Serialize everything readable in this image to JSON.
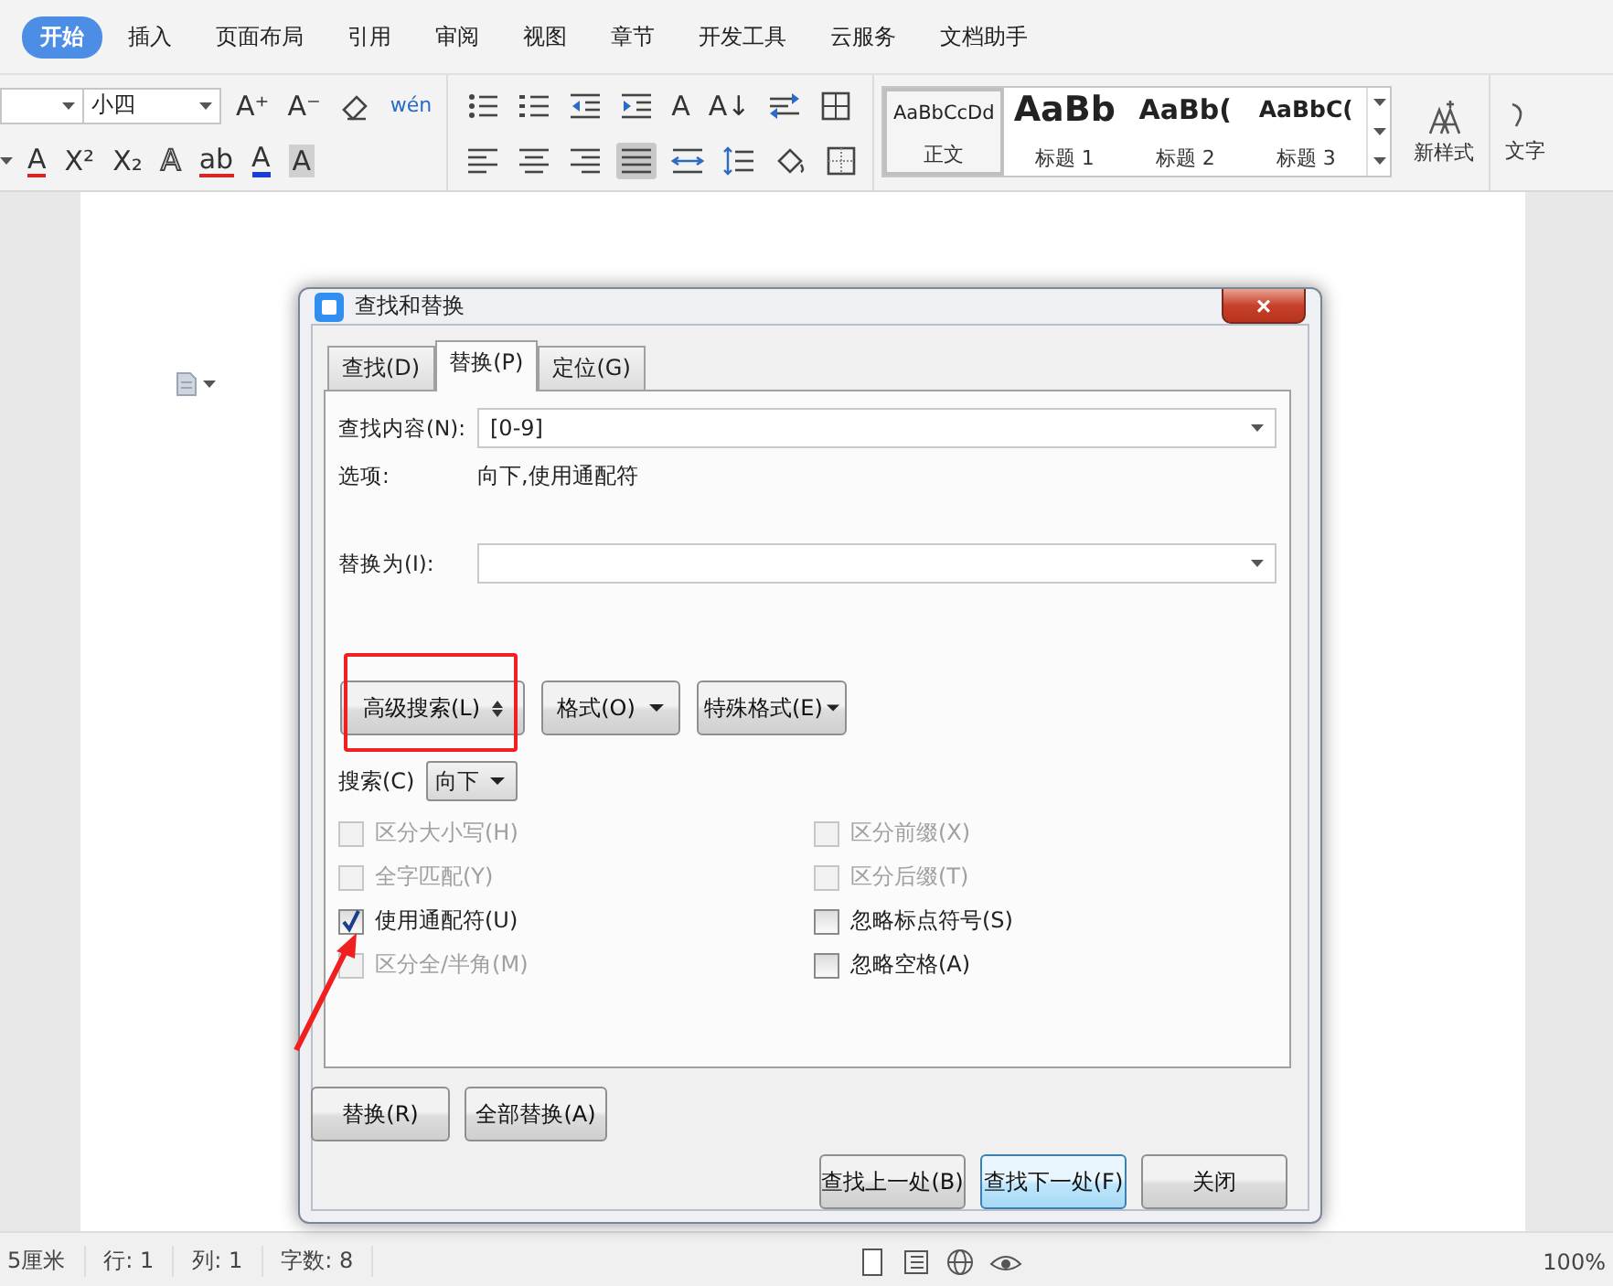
{
  "ribbon_tabs": [
    {
      "label": "开始",
      "selected": true
    },
    {
      "label": "插入",
      "selected": false
    },
    {
      "label": "页面布局",
      "selected": false
    },
    {
      "label": "引用",
      "selected": false
    },
    {
      "label": "审阅",
      "selected": false
    },
    {
      "label": "视图",
      "selected": false
    },
    {
      "label": "章节",
      "selected": false
    },
    {
      "label": "开发工具",
      "selected": false
    },
    {
      "label": "云服务",
      "selected": false
    },
    {
      "label": "文档助手",
      "selected": false
    }
  ],
  "toolbar": {
    "font_size": "小四",
    "font_row1": [
      {
        "kind": "glyph",
        "text": "A⁺"
      },
      {
        "kind": "glyph",
        "text": "A⁻"
      },
      {
        "kind": "eraser"
      },
      {
        "kind": "pinyin",
        "text": "wén"
      }
    ],
    "font_row2": [
      {
        "kind": "strike",
        "text": "A"
      },
      {
        "kind": "glyph",
        "text": "X²"
      },
      {
        "kind": "sub",
        "text": "X₂"
      },
      {
        "kind": "outline",
        "text": "A"
      },
      {
        "kind": "highlight",
        "text": "ab"
      },
      {
        "kind": "color",
        "text": "A"
      },
      {
        "kind": "shade",
        "text": "A"
      }
    ],
    "para_row1": [
      {
        "kind": "bullets"
      },
      {
        "kind": "numbering"
      },
      {
        "kind": "outdent"
      },
      {
        "kind": "indent"
      },
      {
        "kind": "glyph",
        "text": "A"
      },
      {
        "kind": "glyph",
        "text": "A↓"
      },
      {
        "kind": "swap"
      },
      {
        "kind": "table"
      }
    ],
    "para_row2": [
      {
        "kind": "align-left",
        "selected": false
      },
      {
        "kind": "align-center",
        "selected": false
      },
      {
        "kind": "align-right",
        "selected": false
      },
      {
        "kind": "justify",
        "selected": true
      },
      {
        "kind": "distribute",
        "selected": false
      },
      {
        "kind": "linespacing",
        "selected": false
      },
      {
        "kind": "fill",
        "selected": false
      },
      {
        "kind": "borders",
        "selected": false
      }
    ],
    "styles": [
      {
        "sample": "AaBbCcDd",
        "name": "正文",
        "selected": true,
        "kind": "body"
      },
      {
        "sample": "AaBb",
        "name": "标题 1",
        "selected": false,
        "kind": "h1"
      },
      {
        "sample": "AaBb(",
        "name": "标题 2",
        "selected": false,
        "kind": "h2"
      },
      {
        "sample": "AaBbC(",
        "name": "标题 3",
        "selected": false,
        "kind": "h3"
      }
    ],
    "new_style": "新样式",
    "cut_label": "文字"
  },
  "dialog": {
    "title": "查找和替换",
    "close": "×",
    "tabs": [
      {
        "label": "查找(D)",
        "selected": false
      },
      {
        "label": "替换(P)",
        "selected": true
      },
      {
        "label": "定位(G)",
        "selected": false
      }
    ],
    "find_label": "查找内容(N):",
    "find_value": "[0-9]",
    "options_label": "选项:",
    "options_value": "向下,使用通配符",
    "replace_label": "替换为(I):",
    "advanced": "高级搜索(L)",
    "format": "格式(O)",
    "special": "特殊格式(E)",
    "search_label": "搜索(C)",
    "search_value": "向下",
    "checkboxes_left": [
      {
        "label": "区分大小写(H)",
        "checked": false,
        "disabled": true
      },
      {
        "label": "全字匹配(Y)",
        "checked": false,
        "disabled": true
      },
      {
        "label": "使用通配符(U)",
        "checked": true,
        "disabled": false
      },
      {
        "label": "区分全/半角(M)",
        "checked": false,
        "disabled": true
      }
    ],
    "checkboxes_right": [
      {
        "label": "区分前缀(X)",
        "checked": false,
        "disabled": true
      },
      {
        "label": "区分后缀(T)",
        "checked": false,
        "disabled": true
      },
      {
        "label": "忽略标点符号(S)",
        "checked": false,
        "disabled": false
      },
      {
        "label": "忽略空格(A)",
        "checked": false,
        "disabled": false
      }
    ],
    "buttons_left": [
      "替换(R)",
      "全部替换(A)"
    ],
    "buttons_right": [
      {
        "label": "查找上一处(B)",
        "focused": false
      },
      {
        "label": "查找下一处(F)",
        "focused": true
      },
      {
        "label": "关闭",
        "focused": false
      }
    ]
  },
  "status_bar": {
    "items": [
      "5厘米",
      "行: 1",
      "列: 1",
      "字数: 8"
    ],
    "zoom": "100%"
  }
}
